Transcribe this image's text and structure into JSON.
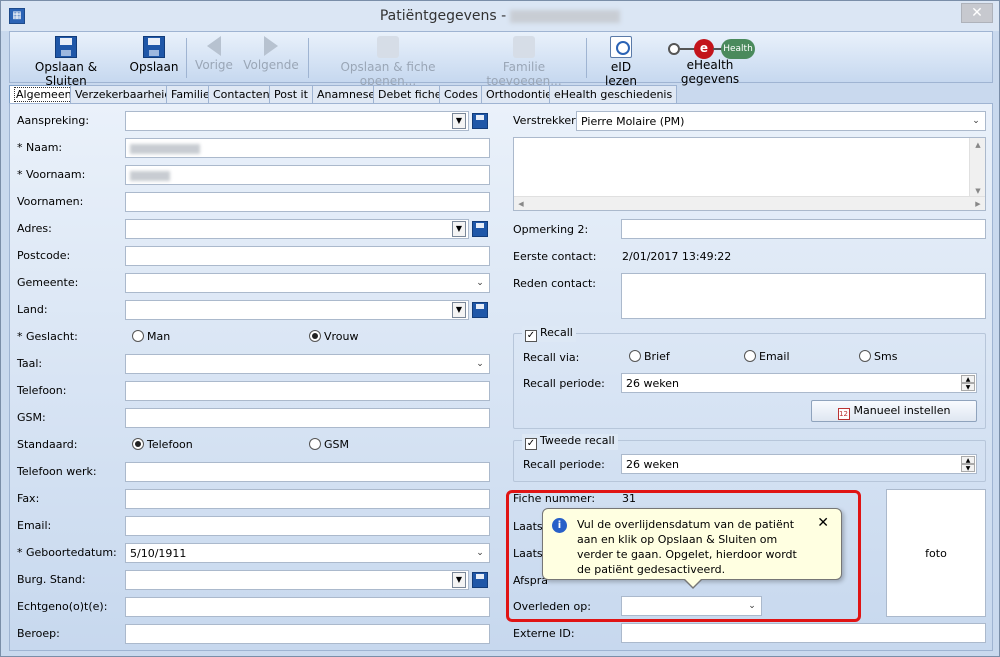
{
  "window": {
    "title": "Patiëntgegevens -",
    "close": "✕"
  },
  "toolbar": {
    "save_close": "Opslaan & Sluiten",
    "save": "Opslaan",
    "prev": "Vorige",
    "next": "Volgende",
    "save_open": "Opslaan & fiche openen...",
    "add_family": "Familie toevoegen...",
    "eid": "eID lezen",
    "ehealth": "eHealth gegevens",
    "ehealth_logo_e": "e",
    "ehealth_logo_text": "Health"
  },
  "tabs": [
    "Algemeen",
    "Verzekerbaarheid",
    "Familie",
    "Contacten",
    "Post it",
    "Anamnese",
    "Debet fiche",
    "Codes",
    "Orthodontie",
    "eHealth geschiedenis"
  ],
  "left": {
    "aanspreking": "Aanspreking:",
    "naam": "* Naam:",
    "voornaam": "* Voornaam:",
    "voornamen": "Voornamen:",
    "adres": "Adres:",
    "postcode": "Postcode:",
    "gemeente": "Gemeente:",
    "land": "Land:",
    "geslacht": "* Geslacht:",
    "man": "Man",
    "vrouw": "Vrouw",
    "taal": "Taal:",
    "telefoon": "Telefoon:",
    "gsm": "GSM:",
    "standaard": "Standaard:",
    "std_telefoon": "Telefoon",
    "std_gsm": "GSM",
    "telefoon_werk": "Telefoon werk:",
    "fax": "Fax:",
    "email": "Email:",
    "geboortedatum": "* Geboortedatum:",
    "geboortedatum_value": "5/10/1911",
    "burg_stand": "Burg. Stand:",
    "echtgenote": "Echtgeno(o)t(e):",
    "beroep": "Beroep:"
  },
  "right": {
    "verstrekker": "Verstrekker:",
    "verstrekker_value": "Pierre Molaire (PM)",
    "opmerking2": "Opmerking 2:",
    "eerste_contact": "Eerste contact:",
    "eerste_contact_value": "2/01/2017 13:49:22",
    "reden_contact": "Reden contact:",
    "recall": "Recall",
    "recall_via": "Recall via:",
    "brief": "Brief",
    "email": "Email",
    "sms": "Sms",
    "recall_periode": "Recall periode:",
    "recall_periode_value": "26 weken",
    "manueel": "Manueel instellen",
    "cal_num": "12",
    "tweede_recall": "Tweede recall",
    "tweede_periode": "Recall periode:",
    "tweede_periode_value": "26 weken",
    "fiche_nummer": "Fiche nummer:",
    "fiche_nummer_value": "31",
    "laatst1": "Laatst",
    "laatst2": "Laatst",
    "afspraak": "Afspra",
    "overleden": "Overleden op:",
    "externe_id": "Externe ID:",
    "foto": "foto"
  },
  "tooltip": {
    "icon": "i",
    "text": "Vul de overlijdensdatum van de patiënt aan en klik op Opslaan & Sluiten om verder te gaan. Opgelet, hierdoor wordt de patiënt gedesactiveerd.",
    "close": "✕"
  }
}
